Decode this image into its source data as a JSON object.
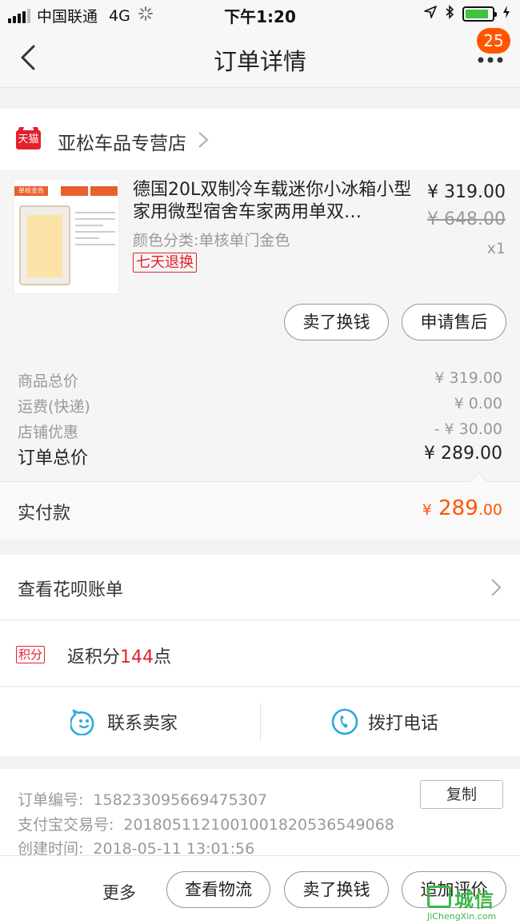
{
  "status_bar": {
    "carrier": "中国联通",
    "network": "4G",
    "time": "下午1:20",
    "battery_level": 0.88
  },
  "nav": {
    "title": "订单详情",
    "badge_count": "25"
  },
  "shop": {
    "badge_label": "天猫",
    "name": "亚松车品专营店"
  },
  "product": {
    "thumb_tag": "单核金色",
    "title": "德国20L双制冷车载迷你小冰箱小型家用微型宿舍车家两用单双…",
    "sku": "颜色分类:单核单门金色",
    "refund_tag": "七天退换",
    "price": "¥ 319.00",
    "original_price": "¥ 648.00",
    "quantity": "x1",
    "sell_button": "卖了换钱",
    "aftersale_button": "申请售后"
  },
  "summary": {
    "rows": [
      {
        "label": "商品总价",
        "value": "¥ 319.00"
      },
      {
        "label": "运费(快递)",
        "value": "¥ 0.00"
      },
      {
        "label": "店铺优惠",
        "value": "- ¥ 30.00"
      }
    ],
    "total_label": "订单总价",
    "total_value": "¥ 289.00"
  },
  "payment": {
    "label": "实付款",
    "currency": "¥",
    "amount_int": "289",
    "amount_dec": ".00"
  },
  "huabei": {
    "label": "查看花呗账单"
  },
  "points": {
    "tag": "积分",
    "prefix": "返积分",
    "value": "144",
    "suffix": "点"
  },
  "contact": {
    "seller_label": "联系卖家",
    "phone_label": "拨打电话"
  },
  "order_info": {
    "order_no_label": "订单编号:",
    "order_no": "1582330956694753​07",
    "alipay_label": "支付宝交易号:",
    "alipay_no": "2018051121001001820536549068",
    "created_label": "创建时间:",
    "created_time": "2018-05-11 13:01:56",
    "copy_button": "复制"
  },
  "bottom_bar": {
    "more_label": "更多",
    "logistics_button": "查看物流",
    "sell_button": "卖了换钱",
    "review_button": "追加评价"
  },
  "watermark": {
    "text": "城信",
    "url": "JiChengXin.com"
  },
  "colors": {
    "accent": "#ff5500",
    "tmall_red": "#e4202c",
    "contact_icon": "#2aa8e0"
  }
}
